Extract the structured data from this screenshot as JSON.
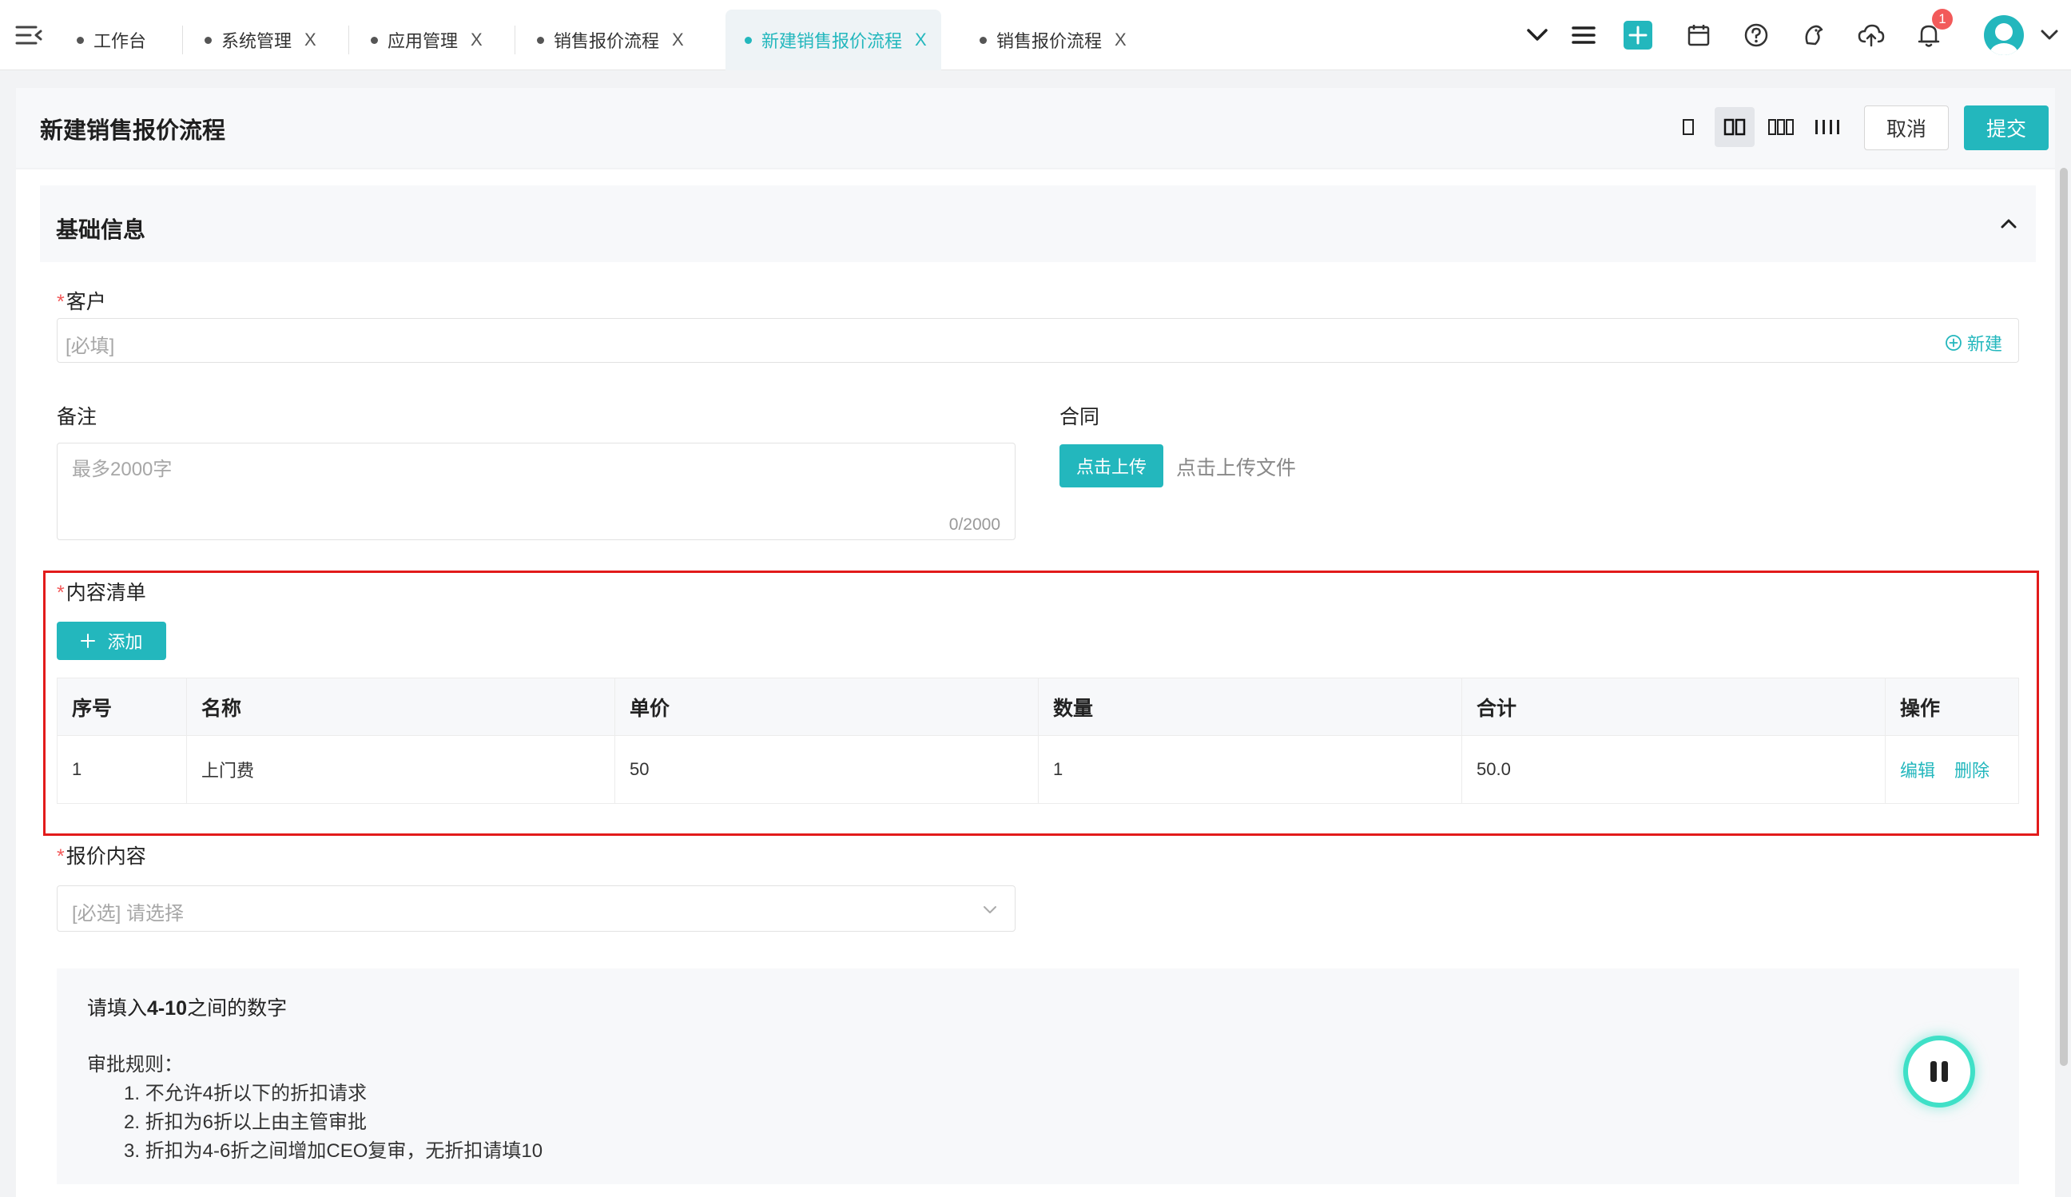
{
  "tabs": [
    {
      "label": "工作台",
      "closable": false,
      "active": false
    },
    {
      "label": "系统管理",
      "closable": true,
      "active": false
    },
    {
      "label": "应用管理",
      "closable": true,
      "active": false
    },
    {
      "label": "销售报价流程",
      "closable": true,
      "active": false
    },
    {
      "label": "新建销售报价流程",
      "closable": true,
      "active": true
    },
    {
      "label": "销售报价流程",
      "closable": true,
      "active": false
    }
  ],
  "tab_close_glyph": "X",
  "topbar_icons": [
    "chevron-down-icon",
    "list-icon",
    "plus-square-icon",
    "calendar-icon",
    "help-icon",
    "bird-icon",
    "cloud-upload-icon",
    "bell-icon",
    "avatar",
    "caret-down-icon"
  ],
  "notifications": {
    "count": "1"
  },
  "page": {
    "title": "新建销售报价流程"
  },
  "layout_options": {
    "selected_columns": 2,
    "options": [
      1,
      2,
      3,
      4
    ]
  },
  "actions": {
    "cancel": "取消",
    "submit": "提交"
  },
  "section": {
    "title": "基础信息"
  },
  "customer": {
    "required_mark": "*",
    "label": "客户",
    "placeholder": "[必填]",
    "new_link": "新建"
  },
  "remark": {
    "label": "备注",
    "placeholder": "最多2000字",
    "counter": "0/2000"
  },
  "contract": {
    "label": "合同",
    "upload_button": "点击上传",
    "upload_hint": "点击上传文件"
  },
  "items": {
    "required_mark": "*",
    "label": "内容清单",
    "add_button": "添加",
    "columns": [
      "序号",
      "名称",
      "单价",
      "数量",
      "合计",
      "操作"
    ],
    "rows": [
      {
        "index": "1",
        "name": "上门费",
        "price": "50",
        "qty": "1",
        "total": "50.0",
        "edit": "编辑",
        "delete": "删除"
      }
    ]
  },
  "quote": {
    "required_mark": "*",
    "label": "报价内容",
    "placeholder": "[必选] 请选择"
  },
  "notice": {
    "title_prefix": "请填入",
    "title_bold": "4-10",
    "title_suffix": "之间的数字",
    "rules_label": "审批规则：",
    "rules": [
      "1. 不允许4折以下的折扣请求",
      "2. 折扣为6折以上由主管审批",
      "3. 折扣为4-6折之间增加CEO复审，无折扣请填10"
    ]
  },
  "colors": {
    "accent": "#23b7bd",
    "required": "#f25a5a",
    "highlight_border": "#e21b1b",
    "floating_ring": "#3fe0c7"
  }
}
